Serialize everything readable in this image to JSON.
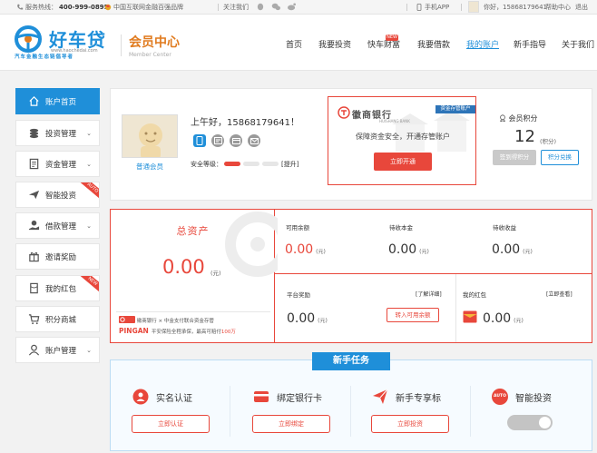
{
  "colors": {
    "primary": "#1f8fd9",
    "accent": "#e8473b",
    "orange": "#e07b1f"
  },
  "topbar": {
    "hotline_label": "服务热线：",
    "hotline": "400-999-0895",
    "org": "中国互联网金融百强品牌",
    "follow": "关注我们",
    "app": "手机APP",
    "user_greeting": "你好，15868179641",
    "help": "帮助中心",
    "logout": "退出"
  },
  "header": {
    "logo_text": "好车贷",
    "logo_url": "www.haochedai.com",
    "logo_slogan": "汽车金融生态链倡导者",
    "member_title": "会员中心",
    "member_sub": "Member Center",
    "nav": [
      "首页",
      "我要投资",
      "快车财富",
      "我要借款",
      "我的账户",
      "新手指导",
      "关于我们"
    ],
    "nav_new_badge": "NEW"
  },
  "sidebar": {
    "items": [
      {
        "label": "账户首页",
        "icon": "home-icon",
        "active": true
      },
      {
        "label": "投资管理",
        "icon": "coins-icon",
        "chevron": true
      },
      {
        "label": "资金管理",
        "icon": "document-icon",
        "chevron": true
      },
      {
        "label": "智能投资",
        "icon": "plane-icon",
        "ribbon": "AUTO"
      },
      {
        "label": "借款管理",
        "icon": "hand-coin-icon",
        "chevron": true
      },
      {
        "label": "邀请奖励",
        "icon": "gift-icon"
      },
      {
        "label": "我的红包",
        "icon": "redpacket-icon",
        "ribbon": "NEW"
      },
      {
        "label": "积分商城",
        "icon": "cart-icon"
      },
      {
        "label": "账户管理",
        "icon": "user-icon",
        "chevron": true
      }
    ]
  },
  "profile": {
    "greeting": "上午好，15868179641！",
    "level": "普通会员",
    "security_label": "安全等级：",
    "security_upgrade": "[提升]",
    "bank_name": "徽商银行",
    "bank_en": "HUISHANG BANK",
    "bank_tag": "资金存管账户",
    "bank_desc": "保障资金安全，开通存管账户",
    "bank_btn": "立即开通",
    "points_label": "会员积分",
    "points_value": "12",
    "points_unit": "(积分)",
    "signin_btn": "签到得积分",
    "exchange_btn": "积分兑换"
  },
  "assets": {
    "total_label": "总资产",
    "total_value": "0.00",
    "unit": "(元)",
    "custody_text": "徽商银行 × 中金支付联合资金存管",
    "pingan_logo": "PINGAN",
    "insurance_pre": "平安保险全程承保，最高可赔付",
    "insurance_amount": "100万",
    "available_label": "可用余额",
    "available_value": "0.00",
    "pending_principal_label": "待收本金",
    "pending_principal_value": "0.00",
    "pending_income_label": "待收收益",
    "pending_income_value": "0.00",
    "reward_label": "平台奖励",
    "reward_link": "[了解详细]",
    "reward_value": "0.00",
    "transfer_btn": "转入可用余额",
    "redpacket_label": "我的红包",
    "redpacket_link": "[立即查看]",
    "redpacket_value": "0.00"
  },
  "tasks": {
    "title": "新手任务",
    "items": [
      {
        "name": "实名认证",
        "btn": "立即认证",
        "icon": "id-badge-icon"
      },
      {
        "name": "绑定银行卡",
        "btn": "立即绑定",
        "icon": "bank-card-icon"
      },
      {
        "name": "新手专享标",
        "btn": "立即投资",
        "icon": "paper-plane-icon"
      },
      {
        "name": "智能投资",
        "icon": "auto-icon",
        "toggle": "off"
      }
    ],
    "auto_badge": "AUTO"
  }
}
